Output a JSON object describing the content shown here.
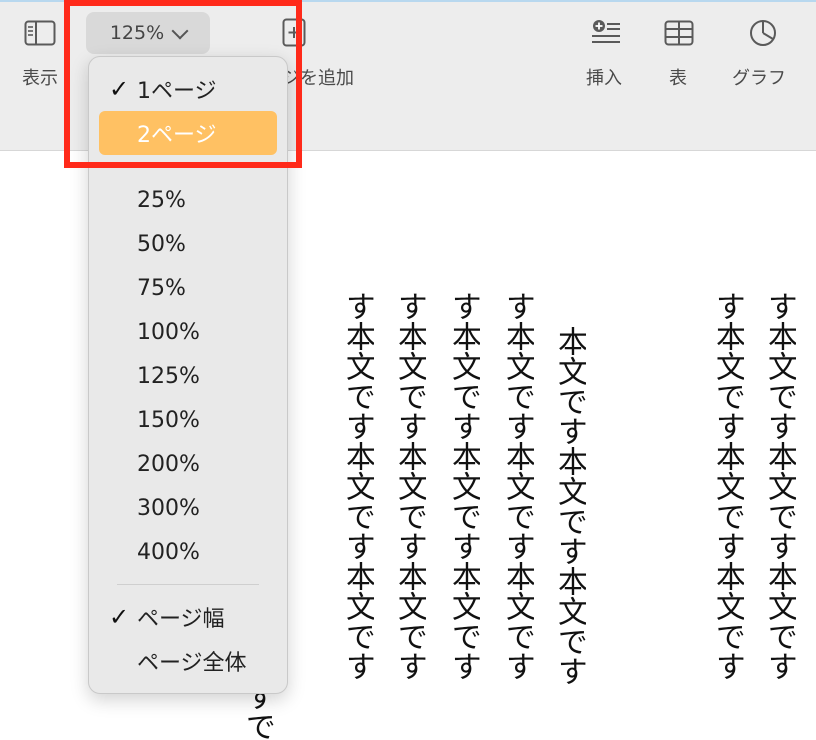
{
  "toolbar": {
    "view_label": "表示",
    "zoom_value": "125%",
    "add_page_label": "ジを追加",
    "insert_label": "挿入",
    "table_label": "表",
    "chart_label": "グラフ"
  },
  "zoom_menu": {
    "items": [
      {
        "label": "1ページ",
        "checked": true
      },
      {
        "label": "2ページ",
        "highlighted": true
      },
      {
        "label": "25%"
      },
      {
        "label": "50%"
      },
      {
        "label": "75%"
      },
      {
        "label": "100%"
      },
      {
        "label": "125%"
      },
      {
        "label": "150%"
      },
      {
        "label": "200%"
      },
      {
        "label": "300%"
      },
      {
        "label": "400%"
      },
      {
        "label": "ページ幅",
        "checked": true
      },
      {
        "label": "ページ全体"
      }
    ],
    "checkmark": "✓",
    "highlight_color": "#ffc163"
  },
  "document": {
    "columns": [
      "すです",
      "す本文です本文です本文です",
      "す本文です本文です本文です",
      "す本文です本文です本文です",
      "す本文です本文です本文です",
      "本文です本文です本文です",
      "す本文です本文です本文です",
      "す本文です本文です本文です"
    ]
  },
  "annotation": {
    "color": "#ff2a1a"
  }
}
